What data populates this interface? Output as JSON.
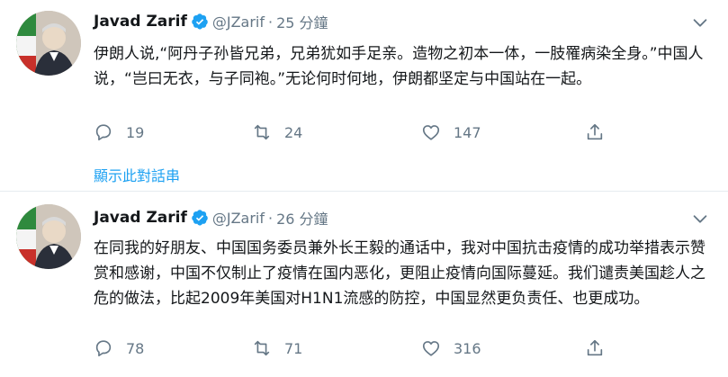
{
  "tweets": [
    {
      "author": "Javad Zarif",
      "handle": "@JZarif",
      "separator": "·",
      "time": "25 分鐘",
      "text": "伊朗人说,“阿丹子孙皆兄弟，兄弟犹如手足亲。造物之初本一体，一肢罹病染全身。”中国人说，“岂曰无衣，与子同袍。”无论何时何地，伊朗都坚定与中国站在一起。",
      "replies": "19",
      "retweets": "24",
      "likes": "147",
      "thread_link": "顯示此對話串"
    },
    {
      "author": "Javad Zarif",
      "handle": "@JZarif",
      "separator": "·",
      "time": "26 分鐘",
      "text": "在同我的好朋友、中国国务委员兼外长王毅的通话中，我对中国抗击疫情的成功举措表示赞赏和感谢，中国不仅制止了疫情在国内恶化，更阻止疫情向国际蔓延。我们谴责美国趁人之危的做法，比起2009年美国对H1N1流感的防控，中国显然更负责任、也更成功。",
      "replies": "78",
      "retweets": "71",
      "likes": "316"
    }
  ],
  "icons": {
    "verified": "verified-badge-icon",
    "caret": "chevron-down-icon",
    "reply": "reply-icon",
    "retweet": "retweet-icon",
    "like": "heart-icon",
    "share": "share-icon"
  },
  "colors": {
    "verified": "#1da1f2",
    "link": "#1da1f2",
    "muted": "#657786",
    "text": "#14171a",
    "divider": "#e6ecf0"
  }
}
